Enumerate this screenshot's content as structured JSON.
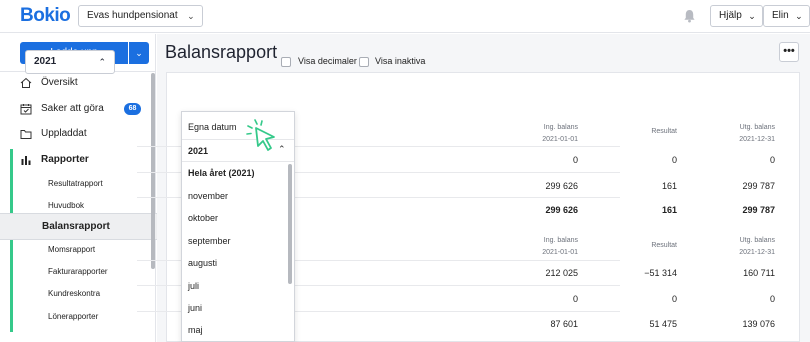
{
  "app": {
    "logo": "Bokio",
    "company": "Evas hundpensionat",
    "help_label": "Hjälp",
    "user_label": "Elin"
  },
  "sidebar": {
    "upload_label": "Ladda upp",
    "items": [
      {
        "label": "Översikt",
        "icon": "house-icon"
      },
      {
        "label": "Saker att göra",
        "icon": "calendar-icon",
        "badge": "68"
      },
      {
        "label": "Uppladdat",
        "icon": "folder-icon"
      },
      {
        "label": "Rapporter",
        "icon": "bar-chart-icon"
      }
    ],
    "reports": [
      "Resultatrapport",
      "Huvudbok",
      "Balansrapport",
      "Momsrapport",
      "Fakturarapporter",
      "Kundreskontra",
      "Lönerapporter"
    ],
    "active_report": "Balansrapport"
  },
  "main": {
    "title": "Balansrapport",
    "more_label": "•••",
    "year_value": "2021",
    "checkboxes": [
      {
        "label": "Visa decimaler",
        "checked": false
      },
      {
        "label": "Visa inaktiva",
        "checked": false
      }
    ],
    "table1": {
      "headers": [
        {
          "name": "Ing. balans",
          "sub": "2021-01-01"
        },
        {
          "name": "Resultat",
          "sub": ""
        },
        {
          "name": "Utg. balans",
          "sub": "2021-12-31"
        }
      ],
      "rows": [
        [
          "0",
          "0",
          "0"
        ],
        [
          "299 626",
          "161",
          "299 787"
        ],
        [
          "299 626",
          "161",
          "299 787"
        ]
      ]
    },
    "table2": {
      "headers": [
        {
          "name": "Ing. balans",
          "sub": "2021-01-01"
        },
        {
          "name": "Resultat",
          "sub": ""
        },
        {
          "name": "Utg. balans",
          "sub": "2021-12-31"
        }
      ],
      "rows": [
        [
          "212 025",
          "−51 314",
          "160 711"
        ],
        [
          "0",
          "0",
          "0"
        ],
        [
          "87 601",
          "51 475",
          "139 076"
        ]
      ]
    }
  },
  "dropdown": {
    "custom_dates": "Egna datum",
    "group_label": "2021",
    "items": [
      "Hela året (2021)",
      "november",
      "oktober",
      "september",
      "augusti",
      "juli",
      "juni",
      "maj"
    ]
  },
  "colors": {
    "brand": "#1b6fe0",
    "accent_green": "#35c98a"
  }
}
